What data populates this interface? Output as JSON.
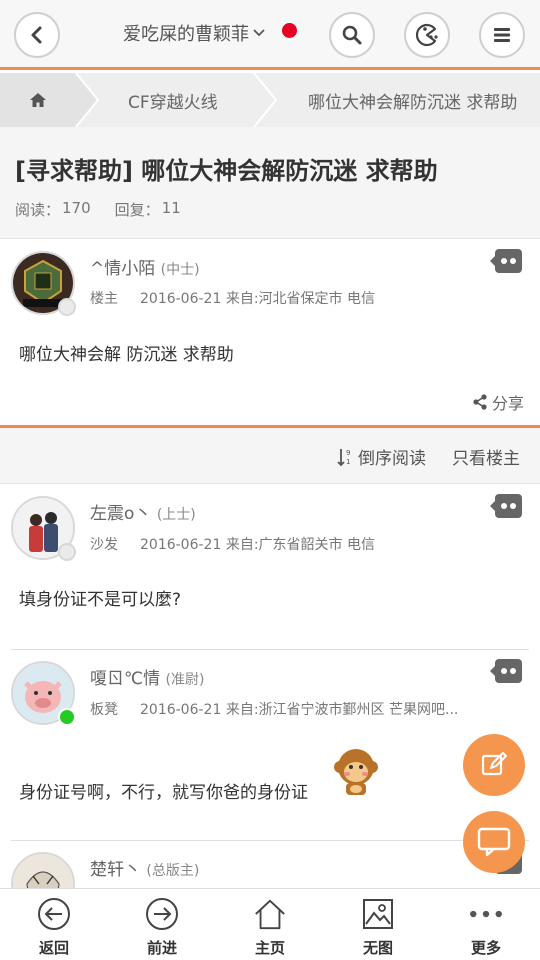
{
  "header": {
    "title": "爱吃屎的曹颖菲",
    "caret": "⌄",
    "icons": {
      "back": "chevron-left-icon",
      "search": "search-icon",
      "game": "pacman-icon",
      "menu": "menu-icon"
    }
  },
  "breadcrumb": {
    "home_icon": "home-icon",
    "forum": "CF穿越火线",
    "thread": "哪位大神会解防沉迷  求帮助"
  },
  "thread": {
    "title": "[寻求帮助] 哪位大神会解防沉迷  求帮助",
    "reads_label": "阅读：",
    "reads": "170",
    "replies_label": "回复：",
    "replies": "11"
  },
  "posts": [
    {
      "name": "^情小陌",
      "rank": "(中士)",
      "floor": "楼主",
      "date": "2016-06-21",
      "source": "来自:河北省保定市 电信",
      "content": "哪位大神会解 防沉迷  求帮助",
      "online": false
    },
    {
      "name": "左震o丶",
      "rank": "(上士)",
      "floor": "沙发",
      "date": "2016-06-21",
      "source": "来自:广东省韶关市 电信",
      "content": "填身份证不是可以麼?",
      "online": false
    },
    {
      "name": "嗄ㄖ℃情",
      "rank": "(准尉)",
      "floor": "板凳",
      "date": "2016-06-21",
      "source": "来自:浙江省宁波市鄞州区 芒果网吧...",
      "content": "身份证号啊，不行，就写你爸的身份证",
      "online": true
    },
    {
      "name": "楚轩丶",
      "rank": "(总版主)"
    }
  ],
  "share_label": "分享",
  "sort": {
    "reverse_label": "倒序阅读",
    "owner_only_label": "只看楼主"
  },
  "bottom_nav": [
    {
      "label": "返回",
      "icon": "arrow-left-circle-icon"
    },
    {
      "label": "前进",
      "icon": "arrow-right-circle-icon"
    },
    {
      "label": "主页",
      "icon": "home-outline-icon"
    },
    {
      "label": "无图",
      "icon": "image-icon"
    },
    {
      "label": "更多",
      "icon": "more-dots-icon"
    }
  ],
  "colors": {
    "accent": "#f28a4f",
    "fab": "#f5964f",
    "online": "#22cc22",
    "notify": "#e60023"
  }
}
